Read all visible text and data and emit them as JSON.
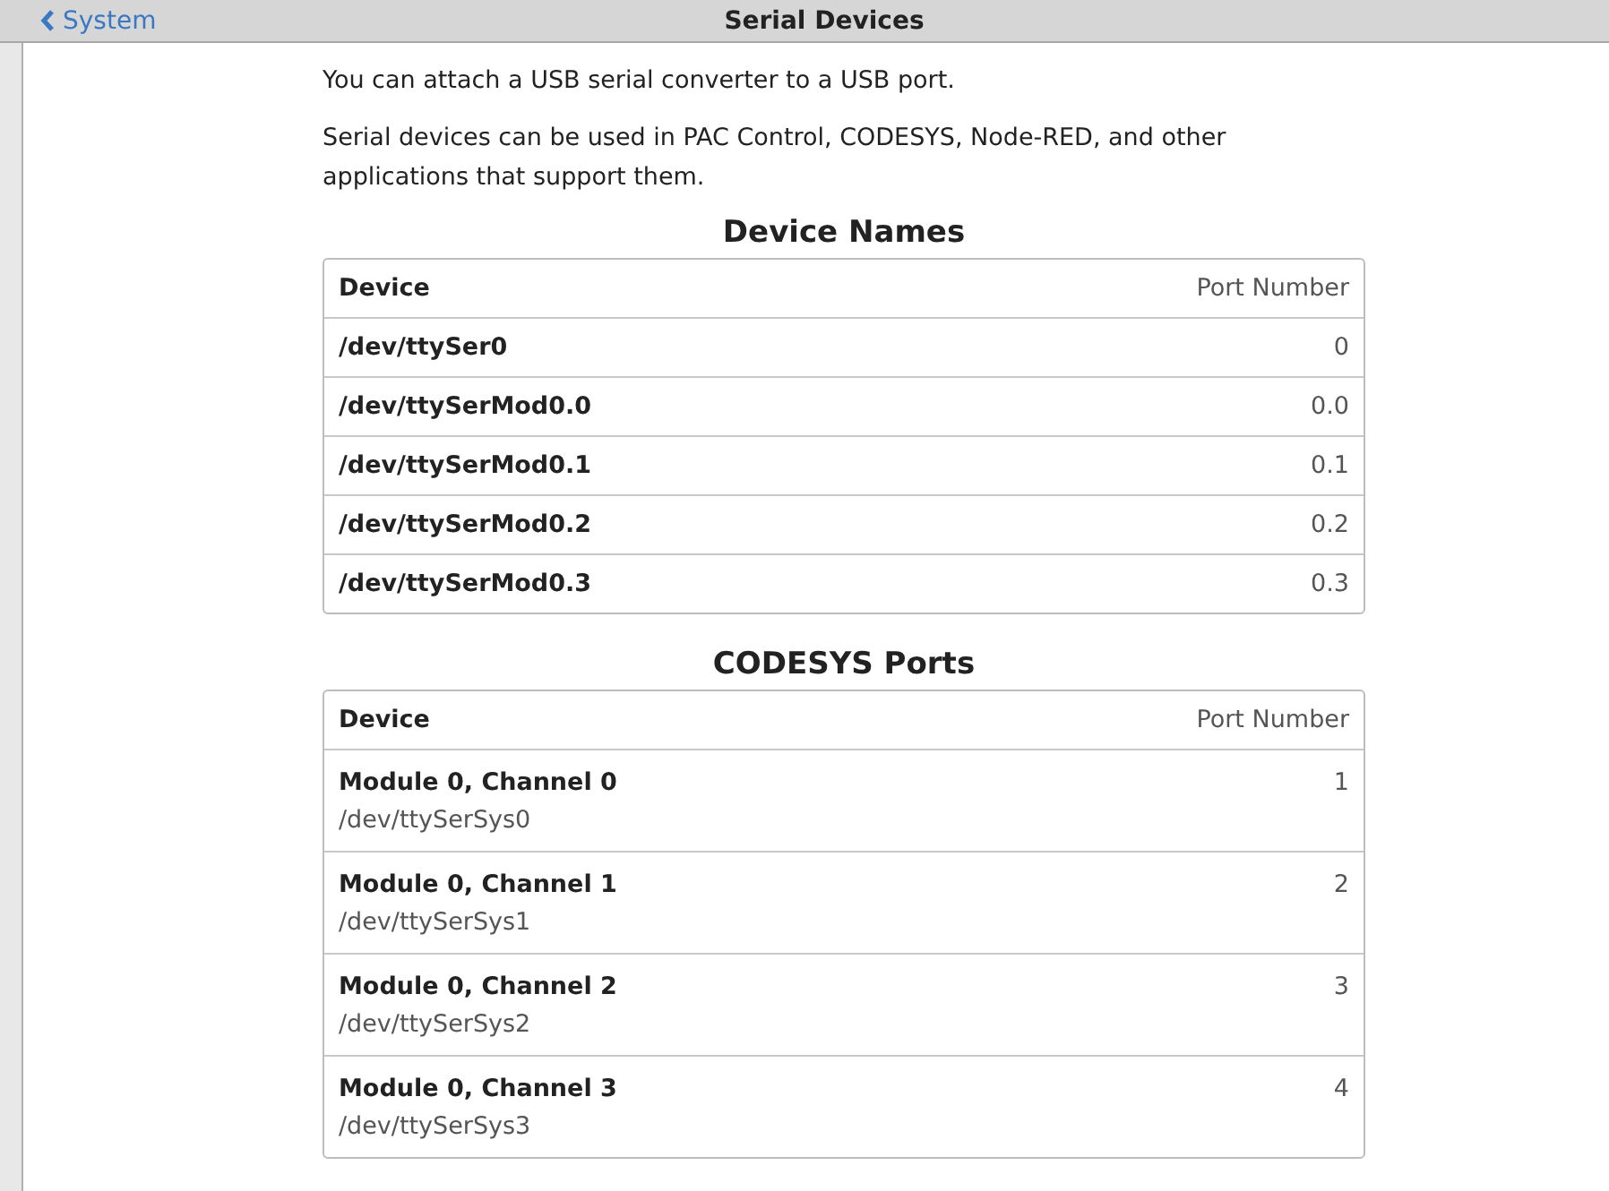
{
  "header": {
    "back_label": "System",
    "title": "Serial Devices"
  },
  "intro": [
    "You can attach a USB serial converter to a USB port.",
    "Serial devices can be used in PAC Control, CODESYS, Node-RED, and other applications that support them."
  ],
  "tables": [
    {
      "title": "Device Names",
      "columns": [
        "Device",
        "Port Number"
      ],
      "rows": [
        {
          "name": "/dev/ttySer0",
          "port": "0"
        },
        {
          "name": "/dev/ttySerMod0.0",
          "port": "0.0"
        },
        {
          "name": "/dev/ttySerMod0.1",
          "port": "0.1"
        },
        {
          "name": "/dev/ttySerMod0.2",
          "port": "0.2"
        },
        {
          "name": "/dev/ttySerMod0.3",
          "port": "0.3"
        }
      ]
    },
    {
      "title": "CODESYS Ports",
      "columns": [
        "Device",
        "Port Number"
      ],
      "rows": [
        {
          "name": "Module 0, Channel 0",
          "detail": "/dev/ttySerSys0",
          "port": "1"
        },
        {
          "name": "Module 0, Channel 1",
          "detail": "/dev/ttySerSys1",
          "port": "2"
        },
        {
          "name": "Module 0, Channel 2",
          "detail": "/dev/ttySerSys2",
          "port": "3"
        },
        {
          "name": "Module 0, Channel 3",
          "detail": "/dev/ttySerSys3",
          "port": "4"
        }
      ]
    }
  ]
}
